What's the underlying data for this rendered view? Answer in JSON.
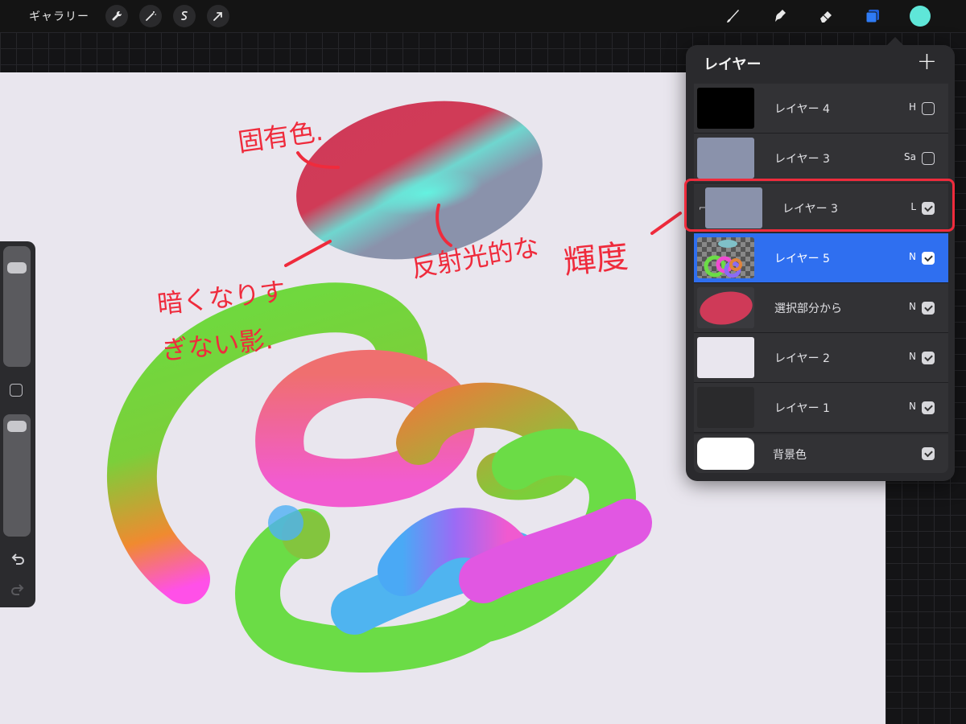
{
  "topbar": {
    "gallery_label": "ギャラリー",
    "left_tools": [
      "wrench-icon",
      "magic-wand-icon",
      "selection-icon",
      "transform-arrow-icon"
    ],
    "right_tools": [
      "brush-icon",
      "smudge-icon",
      "eraser-icon",
      "layers-icon"
    ],
    "current_color": "#5fe6d8"
  },
  "canvas": {
    "annotations": [
      "固有色.",
      "暗くなりすぎない影.",
      "反射光的な",
      "輝度"
    ]
  },
  "layers_panel": {
    "title": "レイヤー",
    "add_symbol": "+",
    "layers": [
      {
        "name": "レイヤー 4",
        "mode": "H",
        "visible": false,
        "thumb": "#000000",
        "clipped": false,
        "active": false
      },
      {
        "name": "レイヤー 3",
        "mode": "Sa",
        "visible": false,
        "thumb": "#8a92ab",
        "clipped": false,
        "active": false
      },
      {
        "name": "レイヤー 3",
        "mode": "L",
        "visible": true,
        "thumb": "#8a92ab",
        "clipped": true,
        "active": false
      },
      {
        "name": "レイヤー 5",
        "mode": "N",
        "visible": true,
        "thumb": "checker",
        "clipped": false,
        "active": true
      },
      {
        "name": "選択部分から",
        "mode": "N",
        "visible": true,
        "thumb": "red-ellipse",
        "clipped": false,
        "active": false
      },
      {
        "name": "レイヤー 2",
        "mode": "N",
        "visible": true,
        "thumb": "#e9e6ee",
        "clipped": false,
        "active": false
      },
      {
        "name": "レイヤー 1",
        "mode": "N",
        "visible": true,
        "thumb": "#2a2a2c",
        "clipped": false,
        "active": false
      }
    ],
    "background": {
      "name": "背景色",
      "visible": true,
      "color": "#ffffff"
    }
  },
  "colors": {
    "accent_blue": "#2f6ff0",
    "annotation_red": "#ef2b3c"
  }
}
